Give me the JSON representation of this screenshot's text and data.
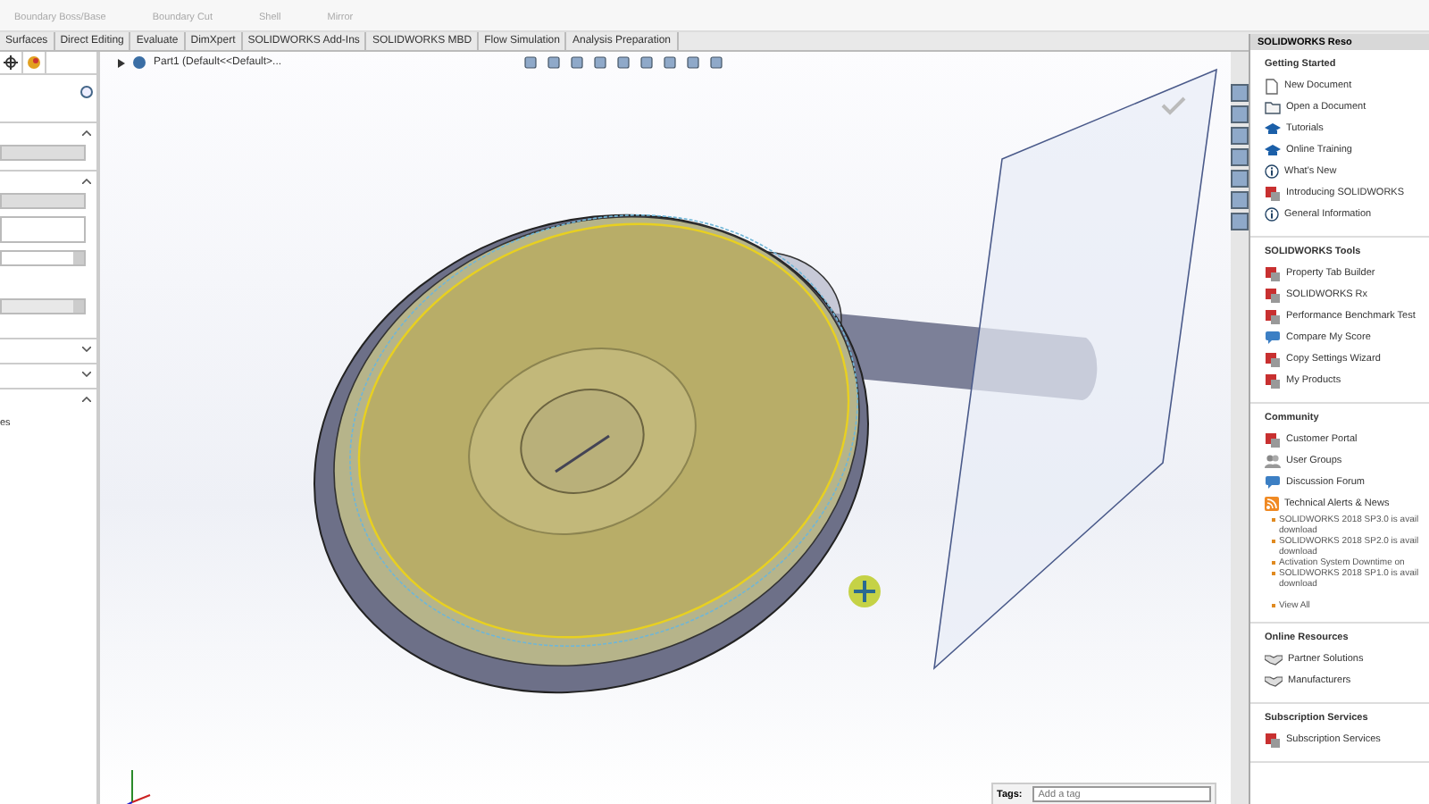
{
  "ribbon": {
    "row2": [
      "Boundary Boss/Base",
      "Boundary Cut",
      "Shell",
      "Mirror"
    ]
  },
  "tabs": [
    "Surfaces",
    "Direct Editing",
    "Evaluate",
    "DimXpert",
    "SOLIDWORKS Add-Ins",
    "SOLIDWORKS MBD",
    "Flow Simulation",
    "Analysis Preparation"
  ],
  "property_panel": {
    "fragment": "es"
  },
  "tree": {
    "label": "Part1  (Default<<Default>..."
  },
  "task_pane": {
    "title": "SOLIDWORKS Reso",
    "sections": [
      {
        "title": "Getting Started",
        "items": [
          {
            "kind": "doc",
            "label": "New Document"
          },
          {
            "kind": "folder",
            "label": "Open a Document"
          },
          {
            "kind": "cap",
            "label": "Tutorials"
          },
          {
            "kind": "cap",
            "label": "Online Training"
          },
          {
            "kind": "info",
            "label": "What's New"
          },
          {
            "kind": "tool",
            "label": "Introducing SOLIDWORKS"
          },
          {
            "kind": "info",
            "label": "General Information"
          }
        ]
      },
      {
        "title": "SOLIDWORKS Tools",
        "items": [
          {
            "kind": "tool",
            "label": "Property Tab Builder"
          },
          {
            "kind": "tool",
            "label": "SOLIDWORKS Rx"
          },
          {
            "kind": "tool",
            "label": "Performance Benchmark Test"
          },
          {
            "kind": "chat",
            "label": "Compare My Score"
          },
          {
            "kind": "tool",
            "label": "Copy Settings Wizard"
          },
          {
            "kind": "tool",
            "label": "My Products"
          }
        ]
      },
      {
        "title": "Community",
        "items": [
          {
            "kind": "tool",
            "label": "Customer Portal"
          },
          {
            "kind": "people",
            "label": "User Groups"
          },
          {
            "kind": "chat",
            "label": "Discussion Forum"
          },
          {
            "kind": "rss",
            "label": "Technical Alerts & News"
          }
        ],
        "news": [
          {
            "text": "SOLIDWORKS 2018 SP3.0 is avail",
            "more": "download"
          },
          {
            "text": "SOLIDWORKS 2018 SP2.0 is avail",
            "more": "download"
          },
          {
            "text": "Activation System Downtime on"
          },
          {
            "text": "SOLIDWORKS 2018 SP1.0 is avail",
            "more": "download"
          }
        ],
        "view_all": "View All"
      },
      {
        "title": "Online Resources",
        "items": [
          {
            "kind": "hand",
            "label": "Partner Solutions"
          },
          {
            "kind": "hand",
            "label": "Manufacturers"
          }
        ]
      },
      {
        "title": "Subscription Services",
        "items": [
          {
            "kind": "tool",
            "label": "Subscription Services"
          }
        ]
      }
    ]
  },
  "tags": {
    "label": "Tags:",
    "placeholder": "Add a tag"
  }
}
